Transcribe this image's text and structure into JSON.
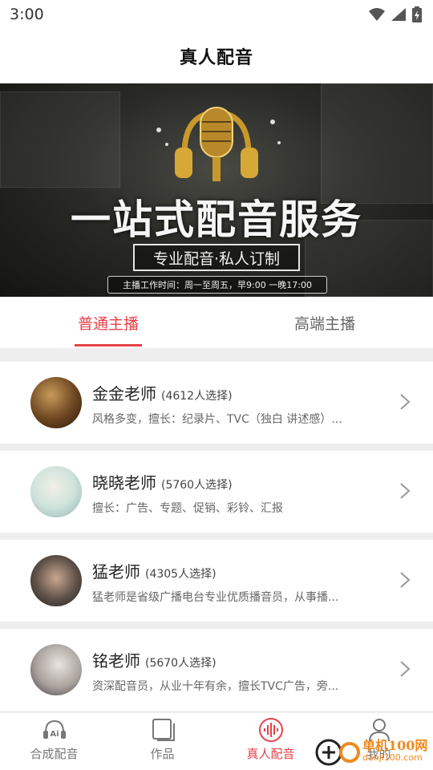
{
  "status_bar": {
    "time": "3:00"
  },
  "header": {
    "title": "真人配音"
  },
  "banner": {
    "headline": "一站式配音服务",
    "subtitle": "专业配音·私人订制",
    "hours": "主播工作时间：周一至周五，早9:00 一晚17:00"
  },
  "tabs": [
    {
      "label": "普通主播",
      "active": true
    },
    {
      "label": "高端主播",
      "active": false
    }
  ],
  "teachers": [
    {
      "name": "金金老师",
      "count": "(4612人选择)",
      "desc": "风格多变，擅长：纪录片、TVC（独白 讲述感）..."
    },
    {
      "name": "晓晓老师",
      "count": "(5760人选择)",
      "desc": "擅长：广告、专题、促销、彩铃、汇报"
    },
    {
      "name": "猛老师",
      "count": "(4305人选择)",
      "desc": "猛老师是省级广播电台专业优质播音员，从事播..."
    },
    {
      "name": "铭老师",
      "count": "(5670人选择)",
      "desc": "资深配音员，从业十年有余，擅长TVC广告，旁..."
    }
  ],
  "bottom_nav": [
    {
      "label": "合成配音",
      "icon": "ai-headset-icon"
    },
    {
      "label": "作品",
      "icon": "works-icon"
    },
    {
      "label": "真人配音",
      "icon": "voice-wave-icon",
      "active": true
    },
    {
      "label": "我的",
      "icon": "user-icon"
    }
  ],
  "watermark": {
    "brand": "单机100网",
    "url": "danji100.com"
  },
  "colors": {
    "accent": "#e8414a",
    "background": "#eeeeee"
  }
}
